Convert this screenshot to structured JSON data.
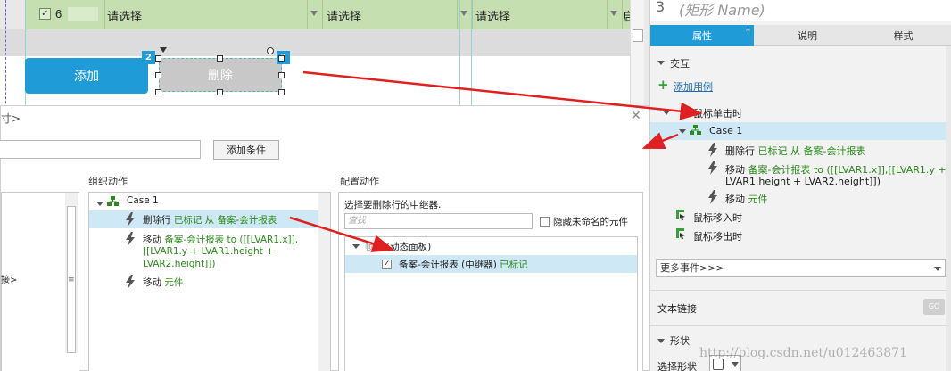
{
  "canvas": {
    "grid_row": {
      "checkbox_value": "6",
      "cells": [
        "请选择",
        "请选择",
        "请选择"
      ],
      "last_cell_fragment": "启"
    },
    "add_button_label": "添加",
    "delete_button_label": "删除",
    "badge_add": "2",
    "badge_delete": "3"
  },
  "dialog": {
    "title_fragment": "寸>",
    "add_condition_label": "添加条件",
    "headers": {
      "organize": "组织动作",
      "configure": "配置动作"
    },
    "left_fragment": "接>",
    "org_tree": {
      "case_label": "Case 1",
      "actions": [
        {
          "verb": "删除行",
          "detail": "已标记 从 备案-会计报表"
        },
        {
          "verb": "移动",
          "detail": "备案-会计报表 to ([[LVAR1.x]],",
          "line2": "[[LVAR1.y + LVAR1.height +",
          "line3": "LVAR2.height]])"
        },
        {
          "verb": "移动",
          "detail": "元件"
        }
      ]
    },
    "configure": {
      "prompt": "选择要删除行的中继器.",
      "search_placeholder": "查找",
      "hide_unnamed_label": "隐藏未命名的元件",
      "group_label": "(动态面板)",
      "group_prefix": "帧",
      "repeater_label": "备案-会计报表 (中继器)",
      "repeater_state": "已标记",
      "repeater_checked": true
    }
  },
  "right_panel": {
    "number": "3",
    "name_placeholder": "(矩形 Name)",
    "tabs": [
      "属性",
      "说明",
      "样式"
    ],
    "active_tab_marker": "*",
    "interaction_header": "交互",
    "add_case_label": "添加用例",
    "click_event_label": "鼠标单击时",
    "case_label": "Case 1",
    "actions": [
      {
        "verb": "删除行",
        "detail": "已标记 从 备案-会计报表"
      },
      {
        "verb": "移动",
        "detail": "备案-会计报表 to ([[LVAR1.x]],[[LVAR1.y +",
        "line2": "LVAR1.height + LVAR2.height]])"
      },
      {
        "verb": "移动",
        "detail": "元件"
      }
    ],
    "mouse_enter_label": "鼠标移入时",
    "mouse_leave_label": "鼠标移出时",
    "more_events_label": "更多事件>>>",
    "text_link_label": "文本链接",
    "link_toggle_label": "GO",
    "shape_header": "形状",
    "shape_select_label": "选择形状"
  },
  "watermark": "http://blog.csdn.net/u012463871",
  "colors": {
    "accent_blue": "#1f9bd7",
    "action_green": "#2a8a1a",
    "annotation_red": "#e02020",
    "grid_green": "#c6dfb1"
  }
}
